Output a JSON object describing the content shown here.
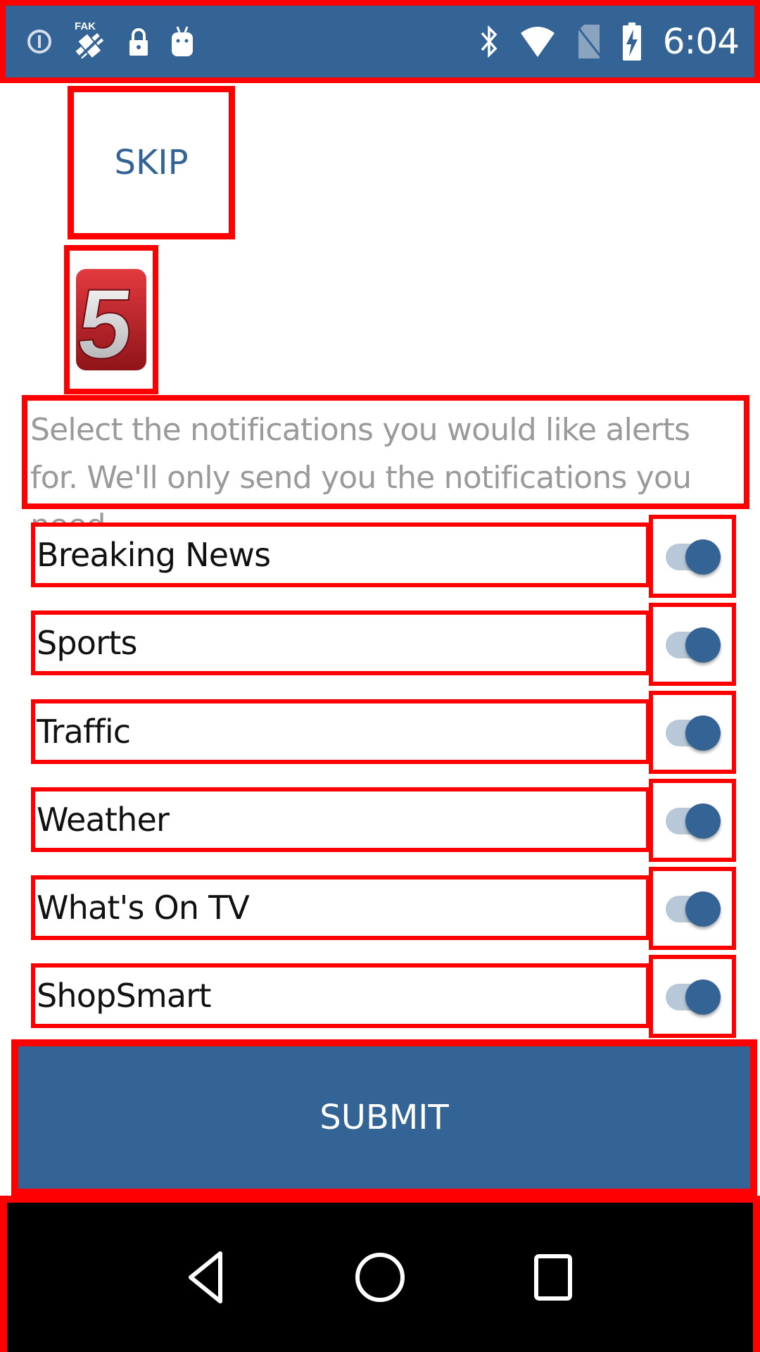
{
  "status_bar": {
    "time": "6:04",
    "left_icons": [
      "info-circle-icon",
      "fake-gps-icon",
      "lock-icon",
      "android-robot-icon"
    ],
    "right_icons": [
      "bluetooth-icon",
      "wifi-icon",
      "no-sim-icon",
      "battery-charging-icon"
    ]
  },
  "skip_label": "SKIP",
  "logo": {
    "name": "channel-5-logo",
    "glyph": "5",
    "color": "#c8252c"
  },
  "description": "Select the notifications you would like alerts for. We'll only send you the notifications you need.",
  "notifications": [
    {
      "label": "Breaking News",
      "enabled": true
    },
    {
      "label": "Sports",
      "enabled": true
    },
    {
      "label": "Traffic",
      "enabled": true
    },
    {
      "label": "Weather",
      "enabled": true
    },
    {
      "label": "What's On TV",
      "enabled": true
    },
    {
      "label": "ShopSmart",
      "enabled": true
    }
  ],
  "submit_label": "SUBMIT",
  "nav_bar": {
    "buttons": [
      "back-icon",
      "home-icon",
      "recents-icon"
    ]
  },
  "colors": {
    "primary": "#346495",
    "annotation": "#ff0000",
    "track": "#b9c8d8"
  }
}
